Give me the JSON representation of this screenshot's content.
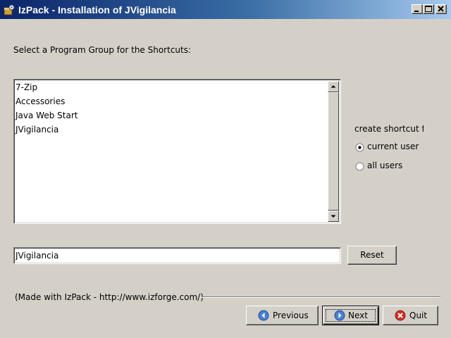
{
  "window": {
    "title": "IzPack - Installation of  JVigilancia",
    "icons": {
      "app": "installer-icon",
      "minimize": "minimize-icon",
      "maximize": "maximize-icon",
      "close": "close-icon"
    }
  },
  "main": {
    "prompt": "Select a Program Group for the Shortcuts:",
    "program_groups": [
      "7-Zip",
      "Accessories",
      "Java Web Start",
      "JVigilancia"
    ],
    "shortcut_options": {
      "label": "create shortcut fo",
      "options": [
        "current user",
        "all users"
      ],
      "selected": "current user"
    },
    "group_name": {
      "value": "JVigilancia"
    },
    "reset_label": "Reset"
  },
  "footer": {
    "credit": "(Made with IzPack - http://www.izforge.com/)",
    "buttons": {
      "previous": {
        "label": "Previous",
        "icon": "arrow-left-icon"
      },
      "next": {
        "label": "Next",
        "icon": "arrow-right-icon"
      },
      "quit": {
        "label": "Quit",
        "icon": "close-circle-icon"
      }
    }
  },
  "colors": {
    "titlebar_start": "#0a246a",
    "titlebar_end": "#a6caf0",
    "face": "#d4d0c8",
    "nav_icon_blue": "#4a7fd0",
    "quit_icon_red": "#d0302a"
  }
}
